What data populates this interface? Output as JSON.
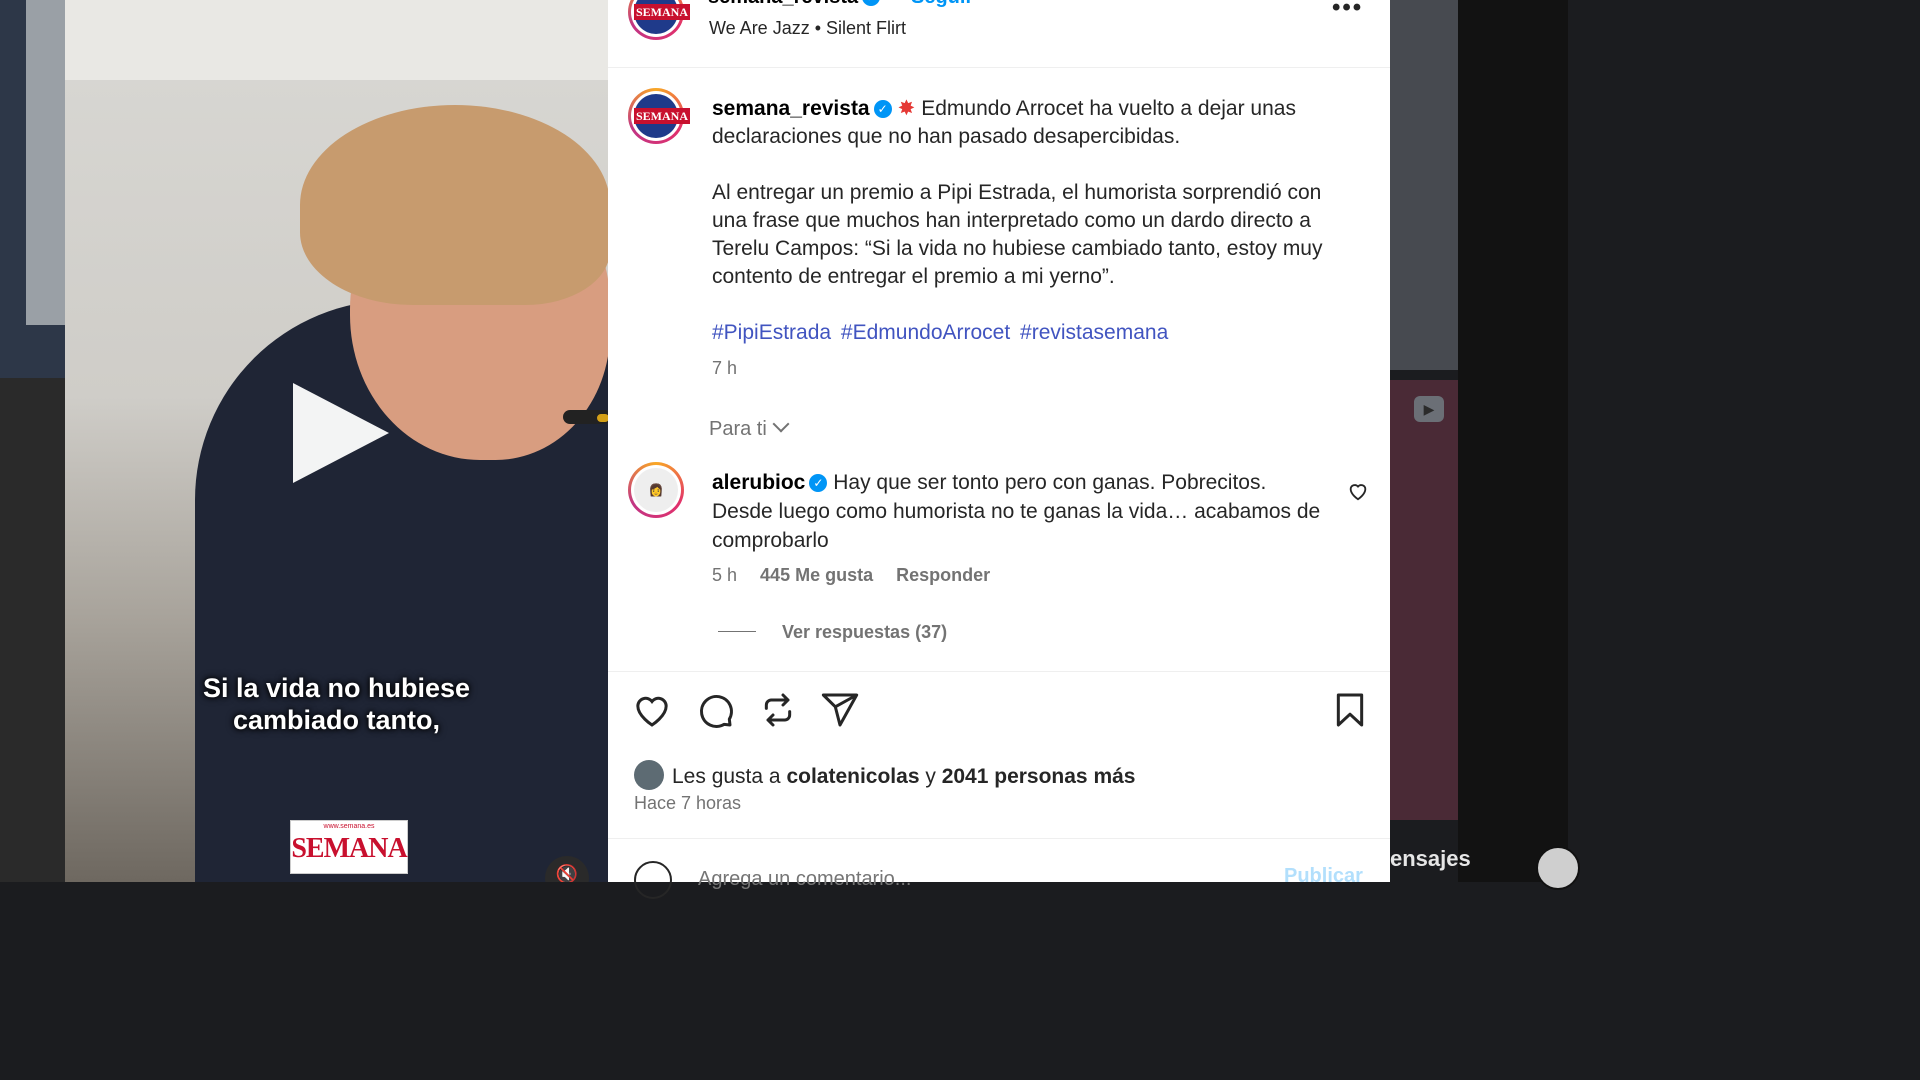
{
  "background": {
    "messages_label": "ensajes"
  },
  "video": {
    "caption_line1": "Si la vida no hubiese",
    "caption_line2": "cambiado tanto,",
    "logo_url": "www.semana.es",
    "logo_name": "SEMANA"
  },
  "header": {
    "username": "semana_revista",
    "follow_label": "Seguir",
    "audio": "We Are Jazz • Silent Flirt",
    "avatar_text": "SEMANA"
  },
  "caption": {
    "username": "semana_revista",
    "line1": "Edmundo Arrocet ha vuelto a dejar unas declaraciones que no han pasado desapercibidas.",
    "line2": "Al entregar un premio a Pipi Estrada, el humorista sorprendió con una frase que muchos han interpretado como un dardo directo a Terelu Campos: “Si la vida no hubiese cambiado tanto, estoy muy contento de entregar el premio a mi yerno”.",
    "hashtags": [
      "#PipiEstrada",
      "#EdmundoArrocet",
      "#revistasemana"
    ],
    "time": "7 h"
  },
  "for_you": "Para ti",
  "comment": {
    "username": "alerubioc",
    "text": "Hay que ser tonto pero con ganas. Pobrecitos. Desde luego como humorista no te ganas la vida… acabamos de comprobarlo",
    "time": "5 h",
    "likes": "445 Me gusta",
    "reply": "Responder",
    "view_replies": "Ver respuestas (37)"
  },
  "likes": {
    "prefix": "Les gusta a",
    "user": "colatenicolas",
    "connector": "y",
    "others": "2041 personas más"
  },
  "posted_ago": "Hace 7 horas",
  "add_comment": {
    "placeholder": "Agrega un comentario...",
    "publish": "Publicar"
  },
  "colors": {
    "accent": "#0095f6",
    "hashtag": "#4154c0",
    "brand_red": "#c8102e"
  }
}
